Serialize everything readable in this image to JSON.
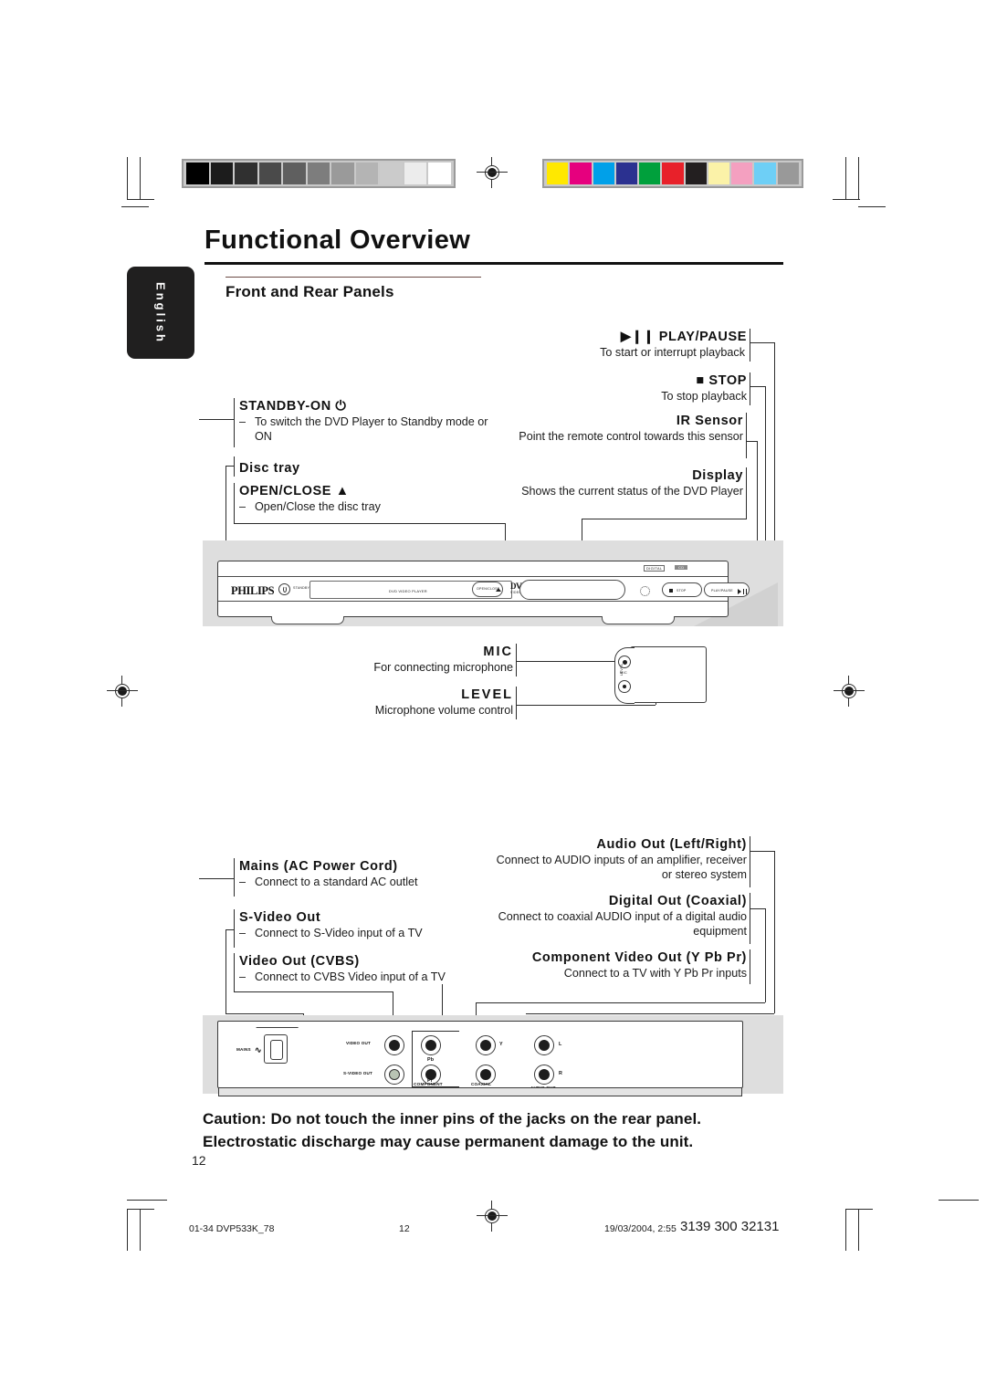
{
  "document": {
    "title": "Functional Overview",
    "subtitle": "Front and Rear Panels",
    "language_tab": "English",
    "page_number": "12"
  },
  "calibration": {
    "grayscale": [
      "#000000",
      "#1c1c1c",
      "#303030",
      "#4a4a4a",
      "#5f5f5f",
      "#7d7d7d",
      "#9a9a9a",
      "#b4b4b4",
      "#cbcbcb",
      "#ececec",
      "#ffffff"
    ],
    "colors": [
      "#ffe800",
      "#e6007e",
      "#00a0e9",
      "#2b3190",
      "#00a03c",
      "#e8212a",
      "#231f20",
      "#fbf2a8",
      "#f4a0c0",
      "#6ecff6",
      "#999999"
    ]
  },
  "front_panel": {
    "callouts": [
      {
        "id": "standby-on",
        "title": "STANDBY-ON ⏻",
        "description": "To switch the DVD Player to Standby mode or ON"
      },
      {
        "id": "disc-tray",
        "title": "Disc tray",
        "description": ""
      },
      {
        "id": "open-close",
        "title": "OPEN/CLOSE ▲",
        "description": "Open/Close the disc tray"
      },
      {
        "id": "play-pause",
        "title": "▶❙❙ PLAY/PAUSE",
        "description": "To start or interrupt playback"
      },
      {
        "id": "stop",
        "title": "■ STOP",
        "description": "To stop playback"
      },
      {
        "id": "ir-sensor",
        "title": "IR Sensor",
        "description": "Point the remote control towards this sensor"
      },
      {
        "id": "display",
        "title": "Display",
        "description": "Shows the current status of the DVD Player"
      },
      {
        "id": "mic",
        "title": "MIC",
        "description": "For connecting microphone"
      },
      {
        "id": "level",
        "title": "LEVEL",
        "description": "Microphone volume control"
      }
    ],
    "device_labels": {
      "brand": "PHILIPS",
      "standby": "STANDBY-ON",
      "disc_slot": "DVD VIDEO PLAYER",
      "open_close": "OPEN/CLOSE",
      "dvd_logo": "DVD",
      "dvd_logo_sub": "VIDEO",
      "stop_button": "STOP",
      "play_button": "PLAY/PAUSE",
      "badge_left": "DIGITAL",
      "badge_right": "CD",
      "mic_jack": "MIC",
      "level_knob": "LEVEL"
    }
  },
  "rear_panel": {
    "callouts": [
      {
        "id": "mains",
        "title": "Mains (AC Power Cord)",
        "description": "Connect to a standard AC outlet"
      },
      {
        "id": "s-video-out",
        "title": "S-Video Out",
        "description": "Connect to S-Video input of a TV"
      },
      {
        "id": "video-out-cvbs",
        "title": "Video Out (CVBS)",
        "description": "Connect to CVBS Video input of a TV"
      },
      {
        "id": "audio-out",
        "title": "Audio Out (Left/Right)",
        "description": "Connect to AUDIO inputs of an amplifier, receiver or stereo system"
      },
      {
        "id": "digital-out",
        "title": "Digital Out (Coaxial)",
        "description": "Connect to coaxial AUDIO input of a digital audio equipment"
      },
      {
        "id": "component-video-out",
        "title": "Component Video Out (Y Pb Pr)",
        "description": "Connect to a TV with Y Pb Pr inputs"
      }
    ],
    "device_labels": {
      "mains": "MAINS",
      "video_out": "VIDEO OUT",
      "s_video_out": "S-VIDEO OUT",
      "pb": "Pb",
      "pr": "Pr",
      "component_video_out": "COMPONENT VIDEO OUT",
      "y": "Y",
      "coaxial": "COAXIAL",
      "digital_out": "DIGITAL OUT",
      "left": "L",
      "right": "R",
      "audio_out": "AUDIO OUT"
    }
  },
  "caution": {
    "line1": "Caution: Do not touch the inner pins of the jacks on the rear panel.",
    "line2": "Electrostatic discharge may cause permanent damage to the unit."
  },
  "footer": {
    "file": "01-34 DVP533K_78",
    "page": "12",
    "timestamp": "19/03/2004, 2:55",
    "code": "3139 300 32131"
  }
}
